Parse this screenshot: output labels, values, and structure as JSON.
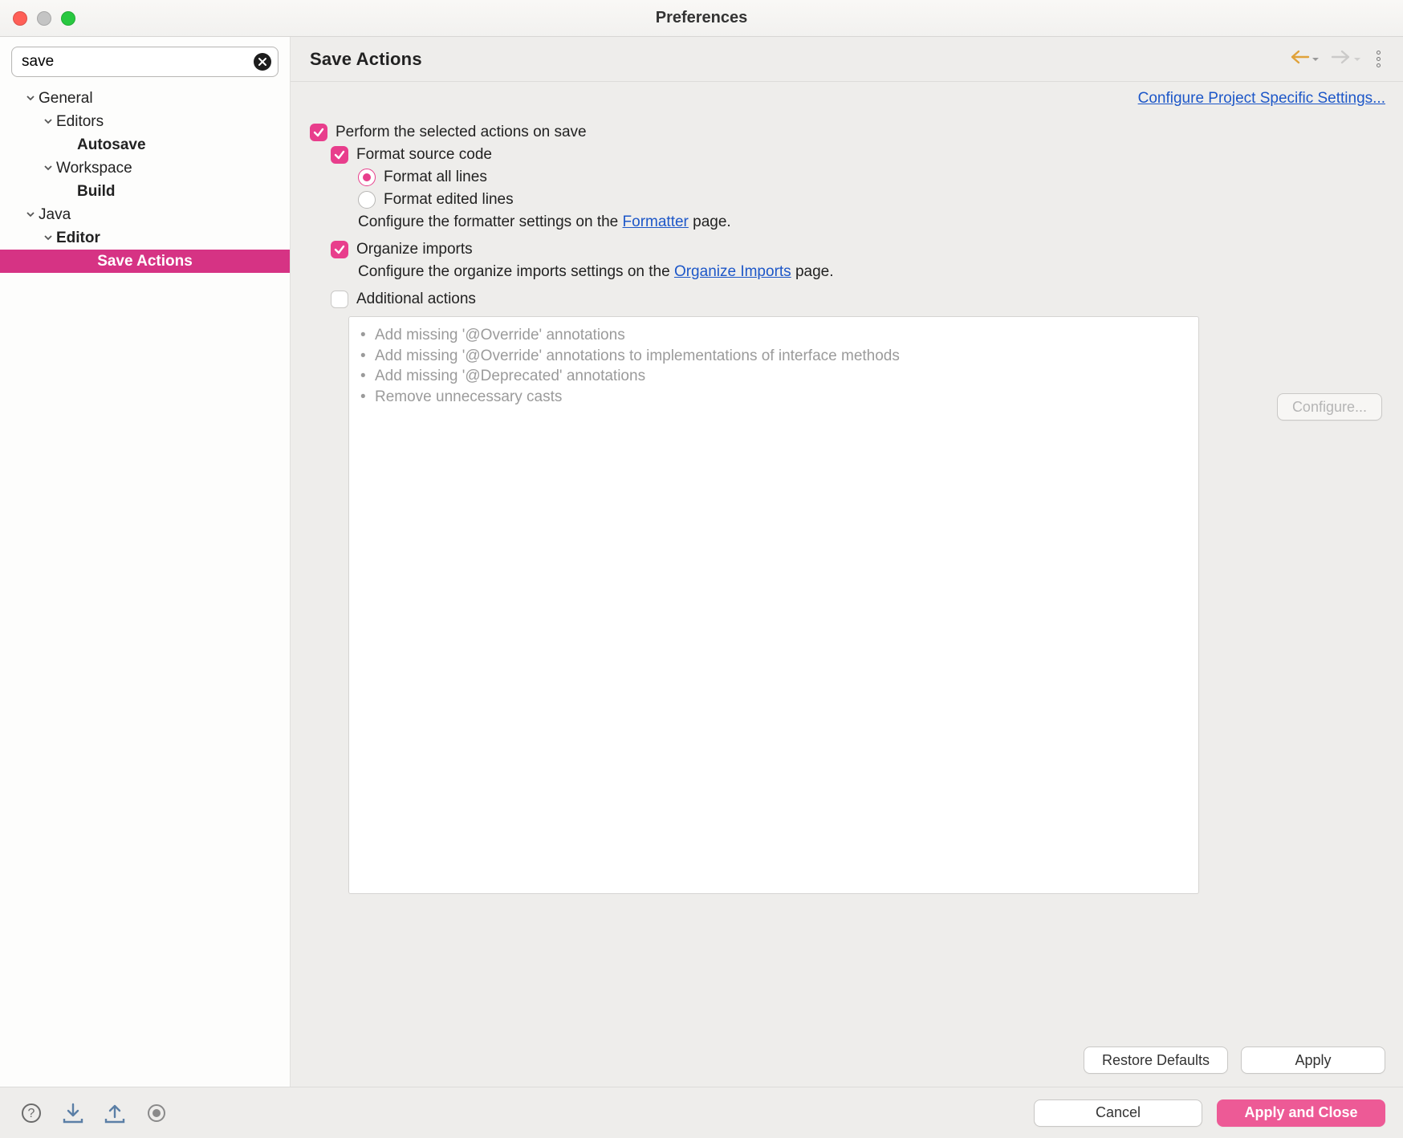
{
  "window": {
    "title": "Preferences"
  },
  "search": {
    "value": "save",
    "clear_tooltip": "Clear"
  },
  "tree": {
    "general": "General",
    "editors": "Editors",
    "autosave": "Autosave",
    "workspace": "Workspace",
    "build": "Build",
    "java": "Java",
    "editor": "Editor",
    "save_actions": "Save Actions"
  },
  "page": {
    "title": "Save Actions",
    "project_link": "Configure Project Specific Settings..."
  },
  "options": {
    "perform_label": "Perform the selected actions on save",
    "perform_checked": true,
    "format_label": "Format source code",
    "format_checked": true,
    "format_all_label": "Format all lines",
    "format_all_selected": true,
    "format_edited_label": "Format edited lines",
    "format_edited_selected": false,
    "formatter_hint_pre": "Configure the formatter settings on the ",
    "formatter_link": "Formatter",
    "formatter_hint_post": " page.",
    "organize_label": "Organize imports",
    "organize_checked": true,
    "organize_hint_pre": "Configure the organize imports settings on the ",
    "organize_link": "Organize Imports",
    "organize_hint_post": " page.",
    "additional_label": "Additional actions",
    "additional_checked": false,
    "additional_list": [
      "Add missing '@Override' annotations",
      "Add missing '@Override' annotations to implementations of interface methods",
      "Add missing '@Deprecated' annotations",
      "Remove unnecessary casts"
    ],
    "configure_btn": "Configure..."
  },
  "buttons": {
    "restore": "Restore Defaults",
    "apply": "Apply",
    "cancel": "Cancel",
    "apply_close": "Apply and Close"
  }
}
